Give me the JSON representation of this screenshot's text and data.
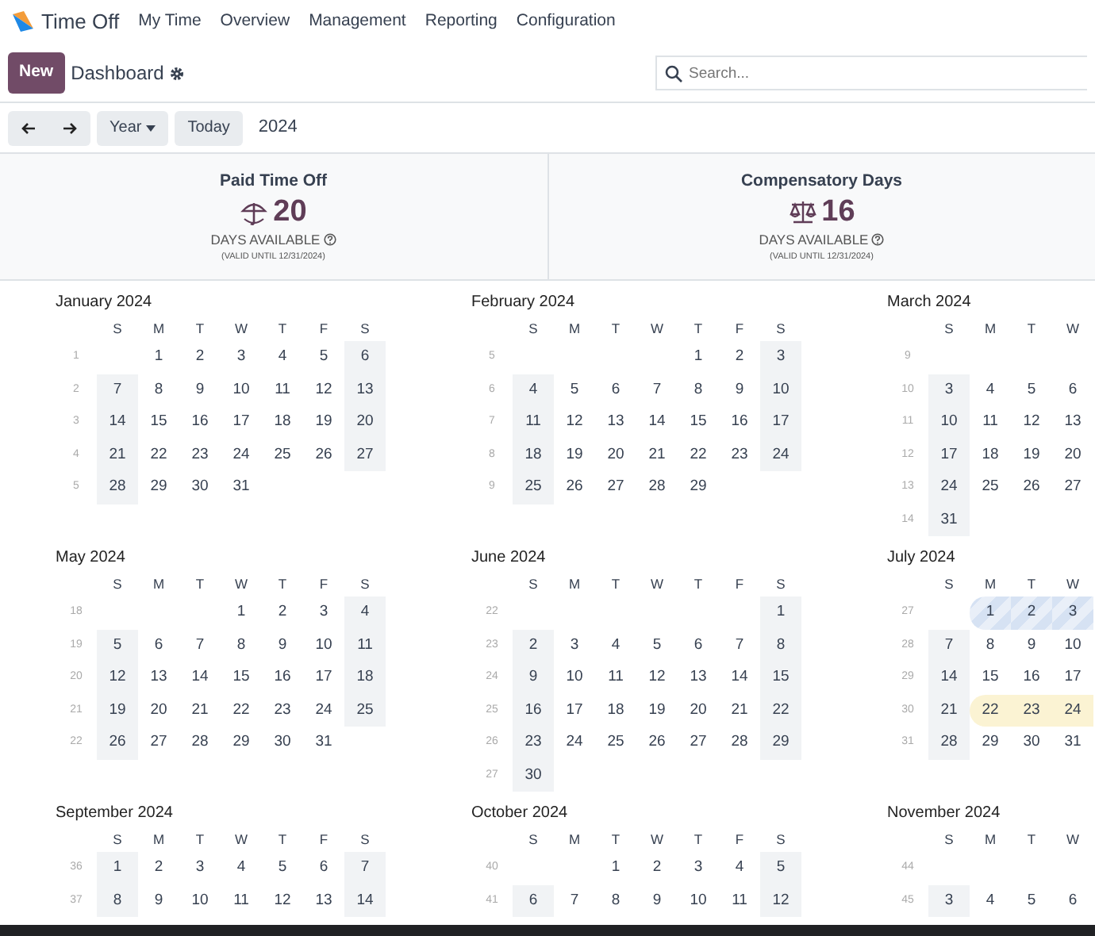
{
  "app": {
    "name": "Time Off"
  },
  "menu": [
    {
      "label": "My Time"
    },
    {
      "label": "Overview"
    },
    {
      "label": "Management"
    },
    {
      "label": "Reporting"
    },
    {
      "label": "Configuration"
    }
  ],
  "control_panel": {
    "new_button": "New",
    "breadcrumb": "Dashboard",
    "search": {
      "placeholder": "Search..."
    }
  },
  "toolbar": {
    "scale": "Year",
    "today": "Today",
    "period": "2024"
  },
  "allocations": [
    {
      "kind": "vacation",
      "name": "Paid Time Off",
      "value": "20",
      "caption": "DAYS AVAILABLE",
      "validity": "(VALID UNTIL 12/31/2024)"
    },
    {
      "kind": "compensatory",
      "name": "Compensatory Days",
      "value": "16",
      "caption": "DAYS AVAILABLE",
      "validity": "(VALID UNTIL 12/31/2024)"
    }
  ],
  "calendar": {
    "months": [
      {
        "title": "January 2024",
        "weekdays": [
          {
            "label": "S",
            "weekend": true
          },
          {
            "label": "M",
            "weekend": false
          },
          {
            "label": "T",
            "weekend": false
          },
          {
            "label": "W",
            "weekend": false
          },
          {
            "label": "T",
            "weekend": false
          },
          {
            "label": "F",
            "weekend": false
          },
          {
            "label": "S",
            "weekend": true
          }
        ],
        "weeks": [
          {
            "number": "1",
            "days": [
              "1",
              "2",
              "3",
              "4",
              "5",
              "6"
            ]
          },
          {
            "number": "2",
            "days": [
              "7",
              "8",
              "9",
              "10",
              "11",
              "12",
              "13"
            ]
          },
          {
            "number": "3",
            "days": [
              "14",
              "15",
              "16",
              "17",
              "18",
              "19",
              "20"
            ]
          },
          {
            "number": "4",
            "days": [
              "21",
              "22",
              "23",
              "24",
              "25",
              "26",
              "27"
            ]
          },
          {
            "number": "5",
            "days": [
              "28",
              "29",
              "30",
              "31"
            ]
          }
        ]
      },
      {
        "title": "February 2024",
        "weekdays": [
          {
            "label": "S",
            "weekend": true
          },
          {
            "label": "M",
            "weekend": false
          },
          {
            "label": "T",
            "weekend": false
          },
          {
            "label": "W",
            "weekend": false
          },
          {
            "label": "T",
            "weekend": false
          },
          {
            "label": "F",
            "weekend": false
          },
          {
            "label": "S",
            "weekend": true
          }
        ],
        "weeks": [
          {
            "number": "5",
            "days": [
              "1",
              "2",
              "3"
            ]
          },
          {
            "number": "6",
            "days": [
              "4",
              "5",
              "6",
              "7",
              "8",
              "9",
              "10"
            ]
          },
          {
            "number": "7",
            "days": [
              "11",
              "12",
              "13",
              "14",
              "15",
              "16",
              "17"
            ]
          },
          {
            "number": "8",
            "days": [
              "18",
              "19",
              "20",
              "21",
              "22",
              "23",
              "24"
            ]
          },
          {
            "number": "9",
            "days": [
              "25",
              "26",
              "27",
              "28",
              "29"
            ]
          }
        ]
      },
      {
        "title": "March 2024",
        "weekdays": [
          {
            "label": "S",
            "weekend": true
          },
          {
            "label": "M",
            "weekend": false
          },
          {
            "label": "T",
            "weekend": false
          },
          {
            "label": "W",
            "weekend": false
          }
        ],
        "weeks": [
          {
            "number": "9"
          },
          {
            "number": "10",
            "days": [
              "3",
              "4",
              "5",
              "6"
            ]
          },
          {
            "number": "11",
            "days": [
              "10",
              "11",
              "12",
              "13"
            ]
          },
          {
            "number": "12",
            "days": [
              "17",
              "18",
              "19",
              "20"
            ]
          },
          {
            "number": "13",
            "days": [
              "24",
              "25",
              "26",
              "27"
            ]
          },
          {
            "number": "14",
            "days": [
              "31"
            ]
          }
        ]
      },
      {
        "title": "May 2024",
        "weekdays": [
          {
            "label": "S",
            "weekend": true
          },
          {
            "label": "M",
            "weekend": false
          },
          {
            "label": "T",
            "weekend": false
          },
          {
            "label": "W",
            "weekend": false
          },
          {
            "label": "T",
            "weekend": false
          },
          {
            "label": "F",
            "weekend": false
          },
          {
            "label": "S",
            "weekend": true
          }
        ],
        "weeks": [
          {
            "number": "18",
            "days": [
              "1",
              "2",
              "3",
              "4"
            ]
          },
          {
            "number": "19",
            "days": [
              "5",
              "6",
              "7",
              "8",
              "9",
              "10",
              "11"
            ]
          },
          {
            "number": "20",
            "days": [
              "12",
              "13",
              "14",
              "15",
              "16",
              "17",
              "18"
            ]
          },
          {
            "number": "21",
            "days": [
              "19",
              "20",
              "21",
              "22",
              "23",
              "24",
              "25"
            ]
          },
          {
            "number": "22",
            "days": [
              "26",
              "27",
              "28",
              "29",
              "30",
              "31"
            ]
          }
        ]
      },
      {
        "title": "June 2024",
        "weekdays": [
          {
            "label": "S",
            "weekend": true
          },
          {
            "label": "M",
            "weekend": false
          },
          {
            "label": "T",
            "weekend": false
          },
          {
            "label": "W",
            "weekend": false
          },
          {
            "label": "T",
            "weekend": false
          },
          {
            "label": "F",
            "weekend": false
          },
          {
            "label": "S",
            "weekend": true
          }
        ],
        "weeks": [
          {
            "number": "22",
            "days": [
              "1"
            ]
          },
          {
            "number": "23",
            "days": [
              "2",
              "3",
              "4",
              "5",
              "6",
              "7",
              "8"
            ]
          },
          {
            "number": "24",
            "days": [
              "9",
              "10",
              "11",
              "12",
              "13",
              "14",
              "15"
            ]
          },
          {
            "number": "25",
            "days": [
              "16",
              "17",
              "18",
              "19",
              "20",
              "21",
              "22"
            ]
          },
          {
            "number": "26",
            "days": [
              "23",
              "24",
              "25",
              "26",
              "27",
              "28",
              "29"
            ]
          },
          {
            "number": "27",
            "days": [
              "30"
            ]
          }
        ]
      },
      {
        "title": "July 2024",
        "weekdays": [
          {
            "label": "S",
            "weekend": true
          },
          {
            "label": "M",
            "weekend": false
          },
          {
            "label": "T",
            "weekend": false
          },
          {
            "label": "W",
            "weekend": false
          }
        ],
        "weeks": [
          {
            "number": "27",
            "days": [
              {
                "text": "1",
                "kind": "pending"
              },
              {
                "text": "2",
                "kind": "pending"
              },
              {
                "text": "3",
                "kind": "pending"
              }
            ]
          },
          {
            "number": "28",
            "days": [
              "7",
              "8",
              "9",
              "10"
            ]
          },
          {
            "number": "29",
            "days": [
              "14",
              "15",
              "16",
              "17"
            ]
          },
          {
            "number": "30",
            "days": [
              "21",
              {
                "text": "22",
                "kind": "holiday"
              },
              {
                "text": "23",
                "kind": "holiday"
              },
              {
                "text": "24",
                "kind": "holiday"
              }
            ]
          },
          {
            "number": "31",
            "days": [
              "28",
              "29",
              "30",
              "31"
            ]
          }
        ]
      },
      {
        "title": "September 2024",
        "weekdays": [
          {
            "label": "S",
            "weekend": true
          },
          {
            "label": "M",
            "weekend": false
          },
          {
            "label": "T",
            "weekend": false
          },
          {
            "label": "W",
            "weekend": false
          },
          {
            "label": "T",
            "weekend": false
          },
          {
            "label": "F",
            "weekend": false
          },
          {
            "label": "S",
            "weekend": true
          }
        ],
        "weeks": [
          {
            "number": "36",
            "days": [
              "1",
              "2",
              "3",
              "4",
              "5",
              "6",
              "7"
            ]
          },
          {
            "number": "37",
            "days": [
              "8",
              "9",
              "10",
              "11",
              "12",
              "13",
              "14"
            ]
          }
        ]
      },
      {
        "title": "October 2024",
        "weekdays": [
          {
            "label": "S",
            "weekend": true
          },
          {
            "label": "M",
            "weekend": false
          },
          {
            "label": "T",
            "weekend": false
          },
          {
            "label": "W",
            "weekend": false
          },
          {
            "label": "T",
            "weekend": false
          },
          {
            "label": "F",
            "weekend": false
          },
          {
            "label": "S",
            "weekend": true
          }
        ],
        "weeks": [
          {
            "number": "40",
            "days": [
              "1",
              "2",
              "3",
              "4",
              "5"
            ]
          },
          {
            "number": "41",
            "days": [
              "6",
              "7",
              "8",
              "9",
              "10",
              "11",
              "12"
            ]
          }
        ]
      },
      {
        "title": "November 2024",
        "weekdays": [
          {
            "label": "S",
            "weekend": true
          },
          {
            "label": "M",
            "weekend": false
          },
          {
            "label": "T",
            "weekend": false
          },
          {
            "label": "W",
            "weekend": false
          }
        ],
        "weeks": [
          {
            "number": "44"
          },
          {
            "number": "45",
            "days": [
              "3",
              "4",
              "5",
              "6"
            ]
          }
        ]
      }
    ]
  }
}
